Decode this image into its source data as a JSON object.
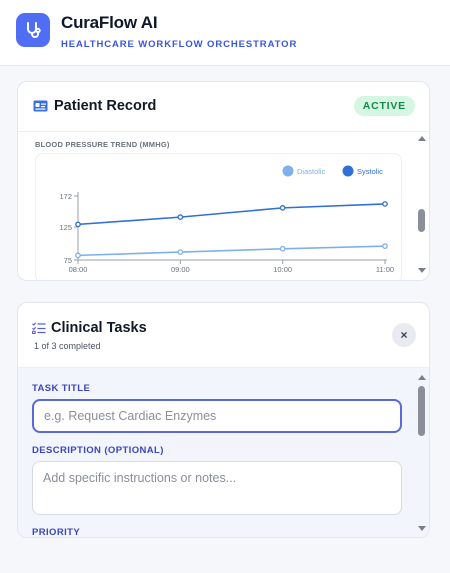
{
  "app": {
    "title": "CuraFlow AI",
    "subtitle": "HEALTHCARE WORKFLOW ORCHESTRATOR",
    "accent": "#4f6df5"
  },
  "patient_record": {
    "title": "Patient Record",
    "status": "ACTIVE",
    "status_color": "#14894a"
  },
  "chart_data": {
    "type": "line",
    "title": "BLOOD PRESSURE TREND (MMHG)",
    "x": [
      "08:00",
      "09:00",
      "10:00",
      "11:00"
    ],
    "yticks": [
      75,
      125,
      172
    ],
    "ylim": [
      75,
      172
    ],
    "legend_position": "top-right",
    "grid": false,
    "series": [
      {
        "name": "Diastolic",
        "color": "#7fb0ec",
        "values": [
          82,
          87,
          92,
          96
        ]
      },
      {
        "name": "Systolic",
        "color": "#2f6fd6",
        "values": [
          129,
          140,
          154,
          160
        ]
      }
    ]
  },
  "clinical_tasks": {
    "title": "Clinical Tasks",
    "progress": "1 of 3 completed",
    "close_symbol": "×",
    "form": {
      "task_title_label": "TASK TITLE",
      "task_title_placeholder": "e.g. Request Cardiac Enzymes",
      "task_title_value": "",
      "description_label": "DESCRIPTION (OPTIONAL)",
      "description_placeholder": "Add specific instructions or notes...",
      "description_value": "",
      "priority_label": "PRIORITY"
    }
  },
  "icons": {
    "logo": "stethoscope-icon",
    "record": "id-card-icon",
    "tasks": "checklist-icon"
  }
}
